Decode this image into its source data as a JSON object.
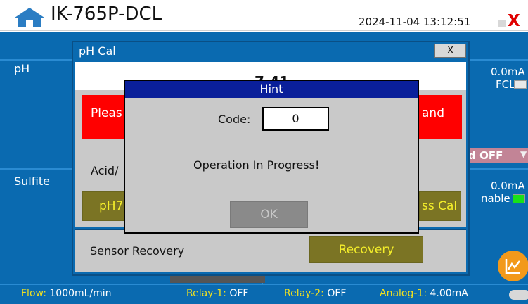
{
  "titlebar": {
    "home_icon": "home-icon",
    "title": "IK-765P-DCL",
    "datetime": "2024-11-04 13:12:51",
    "close_icon": "x-close-icon",
    "close_label": "X"
  },
  "main": {
    "sections": [
      {
        "label": "pH",
        "right_value": "0.0mA",
        "right_toggle_label": "FCL"
      },
      {
        "label": "Sulfite",
        "right_value": "0.0mA",
        "right_toggle_label": "nable"
      }
    ],
    "hold_label": "ld OFF",
    "trend_icon": "trend-chart-icon"
  },
  "statusbar": {
    "flow_label": "Flow:",
    "flow_value": "1000mL/min",
    "relay1_label": "Relay-1:",
    "relay1_value": "OFF",
    "relay2_label": "Relay-2:",
    "relay2_value": "OFF",
    "analog1_label": "Analog-1:",
    "analog1_value": "4.00mA"
  },
  "ph_cal": {
    "title": "pH Cal",
    "close_label": "X",
    "value": "7.41",
    "message_left": "Pleas",
    "message_right": "and",
    "acid_label": "Acid/",
    "ph7_button": "pH7",
    "pass_cal_button": "ss Cal",
    "sensor_recovery_label": "Sensor Recovery",
    "recovery_button": "Recovery"
  },
  "hint": {
    "title": "Hint",
    "code_label": "Code:",
    "code_value": "0",
    "message": "Operation In Progress!",
    "ok_button": "OK"
  },
  "colors": {
    "main_blue": "#0a6ab0",
    "hint_header": "#0a1f9a",
    "alert_red": "#ff0000",
    "button_olive": "#7b7424",
    "button_text": "#f4ee2a",
    "status_text": "#f0e020"
  }
}
